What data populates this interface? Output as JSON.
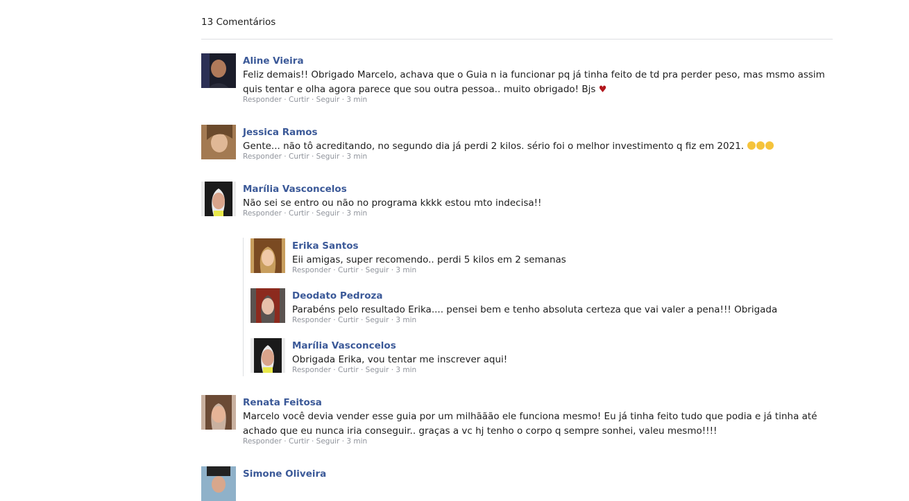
{
  "header": {
    "count_label": "13 Comentários"
  },
  "actions": {
    "reply": "Responder",
    "like": "Curtir",
    "follow": "Seguir",
    "sep": "·"
  },
  "comments": [
    {
      "author": "Aline Vieira",
      "text": "Feliz demais!! Obrigado Marcelo, achava que o Guia n ia funcionar pq já tinha feito de td pra perder peso, mas msmo assim quis tentar e olha agora parece que sou outra pessoa.. muito obrigado! Bjs",
      "emoji": "♥",
      "time": "3 min"
    },
    {
      "author": "Jessica Ramos",
      "text": "Gente... não tô acreditando, no segundo dia já perdi 2 kilos. sério foi o melhor investimento q fiz em 2021.",
      "time": "3 min"
    },
    {
      "author": "Marília Vasconcelos",
      "text": "Não sei se entro ou não no programa kkkk estou mto indecisa!!",
      "time": "3 min"
    },
    {
      "author": "Erika Santos",
      "text": "Eii amigas, super recomendo.. perdi 5 kilos em 2 semanas",
      "time": "3 min"
    },
    {
      "author": "Deodato Pedroza",
      "text": "Parabéns pelo resultado Erika.... pensei bem e tenho absoluta certeza que vai valer a pena!!! Obrigada",
      "time": "3 min"
    },
    {
      "author": "Marília Vasconcelos",
      "text": "Obrigada Erika, vou tentar me inscrever aqui!",
      "time": "3 min"
    },
    {
      "author": "Renata Feitosa",
      "text": "Marcelo você devia vender esse guia por um milhããão ele funciona mesmo! Eu já tinha feito tudo que podia e já tinha até achado que eu nunca iria conseguir.. graças a vc hj tenho o corpo q sempre sonhei, valeu mesmo!!!!",
      "time": "3 min"
    },
    {
      "author": "Simone Oliveira"
    }
  ]
}
